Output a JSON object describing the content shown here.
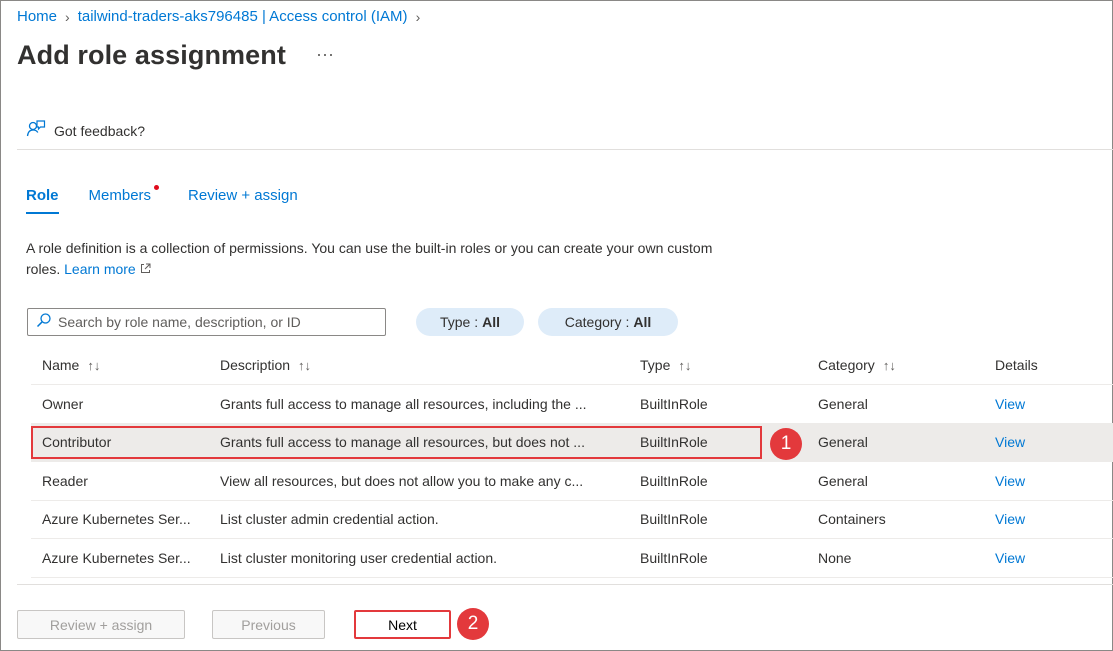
{
  "breadcrumb": {
    "home": "Home",
    "resource": "tailwind-traders-aks796485 | Access control (IAM)"
  },
  "page": {
    "title": "Add role assignment",
    "more": "···"
  },
  "feedback": {
    "label": "Got feedback?"
  },
  "tabs": [
    {
      "label": "Role"
    },
    {
      "label": "Members"
    },
    {
      "label": "Review + assign"
    }
  ],
  "description": {
    "text": "A role definition is a collection of permissions. You can use the built-in roles or you can create your own custom roles.",
    "link": "Learn more"
  },
  "search": {
    "placeholder": "Search by role name, description, or ID"
  },
  "filters": {
    "type": {
      "label": "Type :",
      "value": "All"
    },
    "category": {
      "label": "Category :",
      "value": "All"
    }
  },
  "table": {
    "headers": {
      "name": "Name",
      "description": "Description",
      "type": "Type",
      "category": "Category",
      "details": "Details"
    },
    "rows": [
      {
        "name": "Owner",
        "description": "Grants full access to manage all resources, including the ...",
        "type": "BuiltInRole",
        "category": "General",
        "details": "View"
      },
      {
        "name": "Contributor",
        "description": "Grants full access to manage all resources, but does not ...",
        "type": "BuiltInRole",
        "category": "General",
        "details": "View"
      },
      {
        "name": "Reader",
        "description": "View all resources, but does not allow you to make any c...",
        "type": "BuiltInRole",
        "category": "General",
        "details": "View"
      },
      {
        "name": "Azure Kubernetes Ser...",
        "description": "List cluster admin credential action.",
        "type": "BuiltInRole",
        "category": "Containers",
        "details": "View"
      },
      {
        "name": "Azure Kubernetes Ser...",
        "description": "List cluster monitoring user credential action.",
        "type": "BuiltInRole",
        "category": "None",
        "details": "View"
      }
    ]
  },
  "markers": {
    "first": "1",
    "second": "2"
  },
  "footer": {
    "review_assign": "Review + assign",
    "previous": "Previous",
    "next": "Next"
  },
  "colors": {
    "accent": "#0078d4",
    "highlight": "#e3393c",
    "pill_bg": "#deecf9"
  }
}
